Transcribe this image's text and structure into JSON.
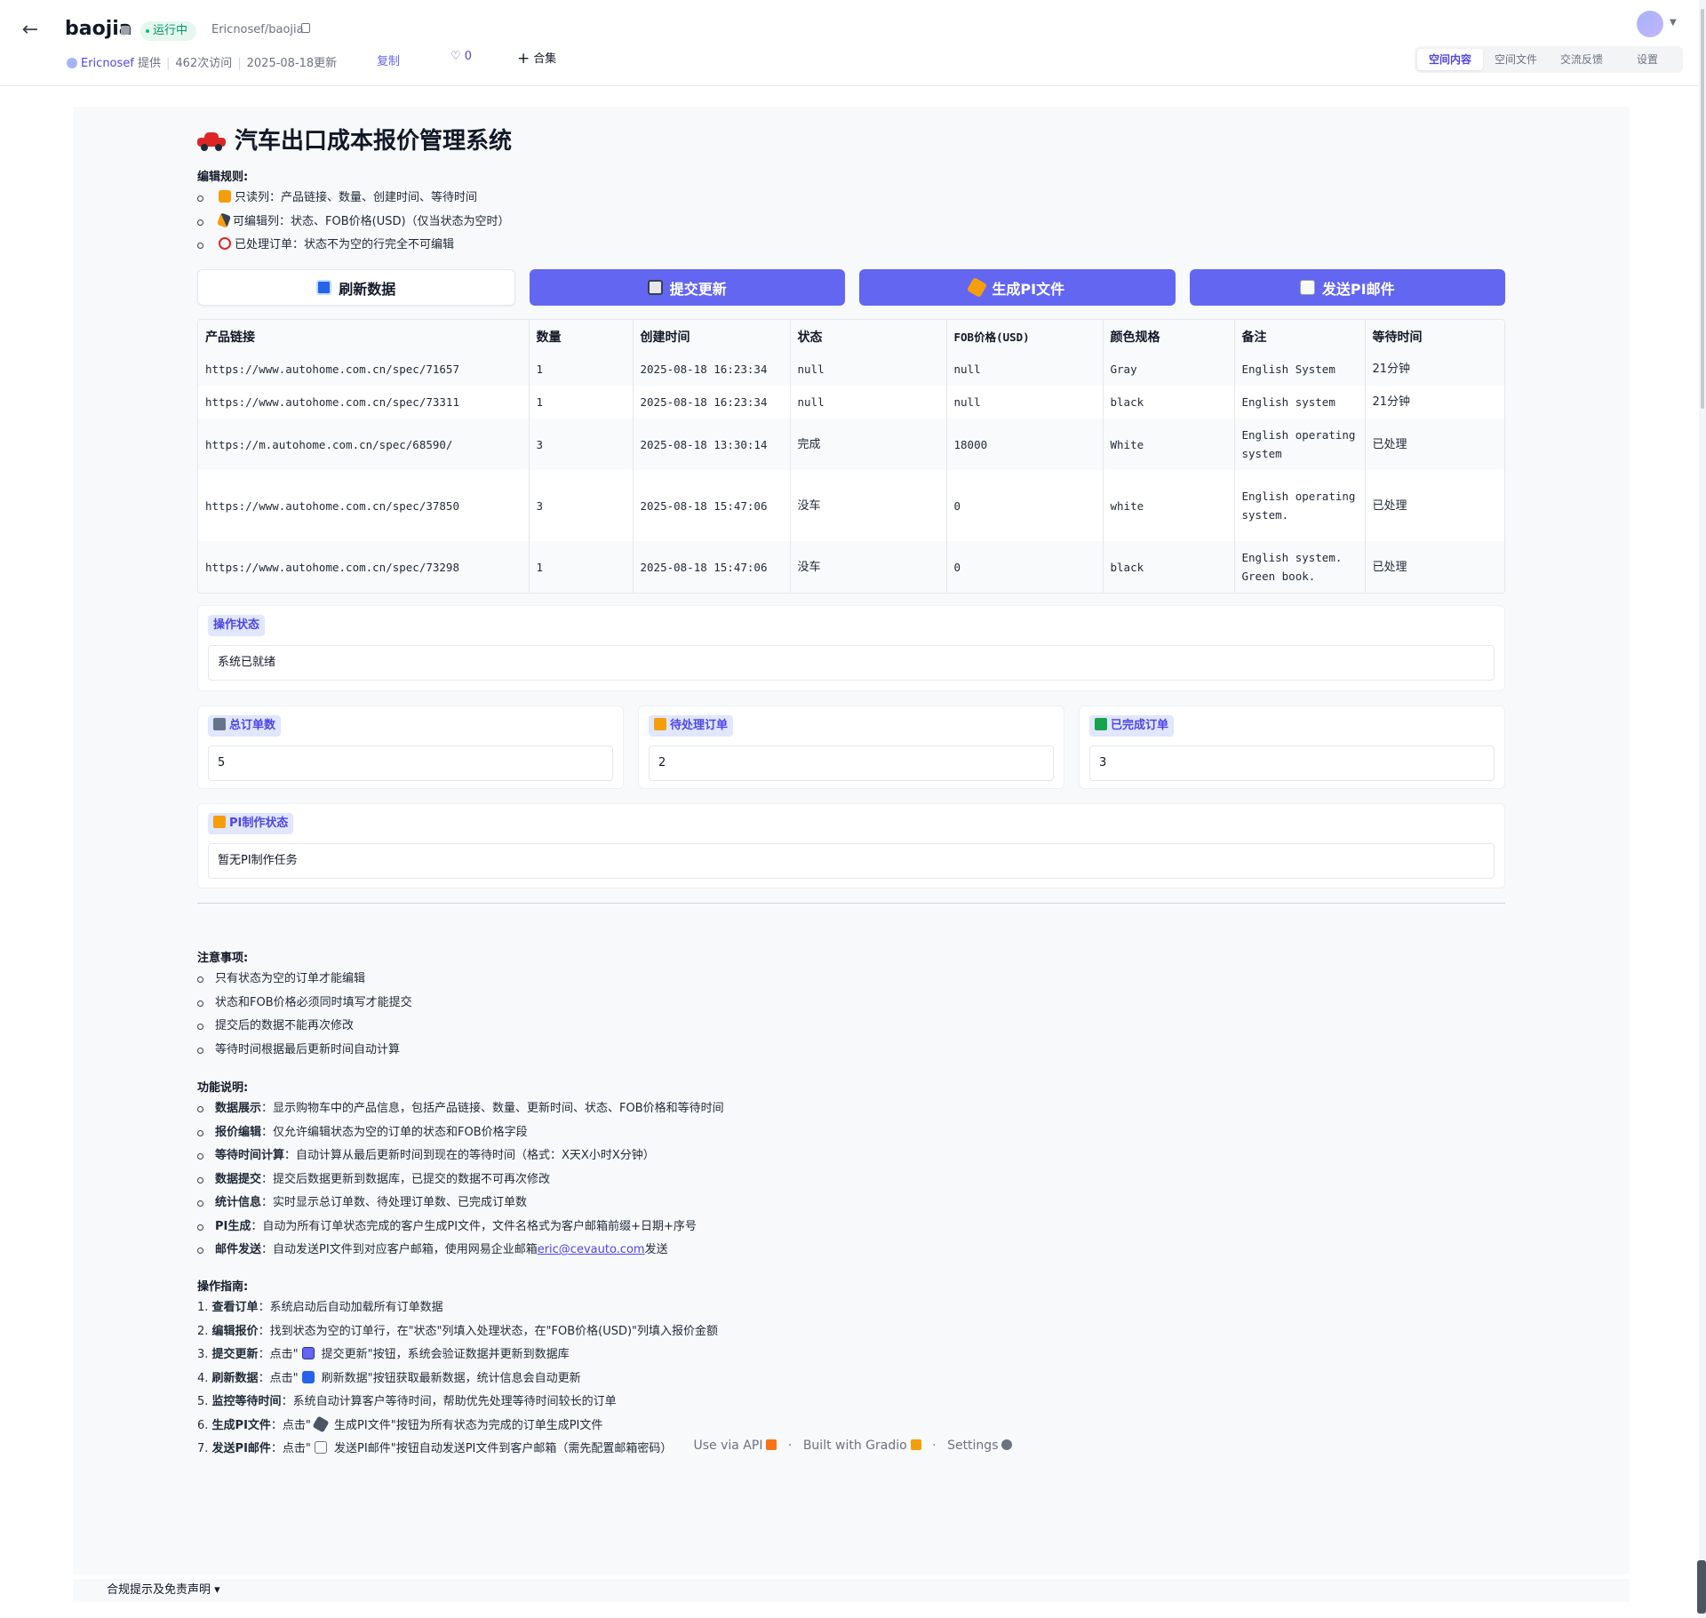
{
  "header": {
    "space_name": "baojia",
    "status": "运行中",
    "repo": "Ericnosef/baojia",
    "author": "Ericnosef",
    "provided": "提供",
    "visits": "462次访问",
    "updated": "2025-08-18更新",
    "copy_label": "复制",
    "likes": "♡ 0",
    "collection": "合集",
    "tabs": [
      "空间内容",
      "空间文件",
      "交流反馈",
      "设置"
    ]
  },
  "app": {
    "title": "汽车出口成本报价管理系统",
    "rules_title": "编辑规则:",
    "rules": [
      {
        "icon": "lock-icon",
        "text": "只读列：产品链接、数量、创建时间、等待时间"
      },
      {
        "icon": "pencil-icon",
        "text": "可编辑列：状态、FOB价格(USD)（仅当状态为空时）"
      },
      {
        "icon": "ban-icon",
        "text": "已处理订单：状态不为空的行完全不可编辑"
      }
    ],
    "buttons": {
      "refresh": "刷新数据",
      "submit": "提交更新",
      "generate_pi": "生成PI文件",
      "send_pi": "发送PI邮件"
    },
    "table": {
      "headers": [
        "产品链接",
        "数量",
        "创建时间",
        "状态",
        "FOB价格(USD)",
        "颜色规格",
        "备注",
        "等待时间"
      ],
      "rows": [
        [
          "https://www.autohome.com.cn/spec/71657",
          "1",
          "2025-08-18 16:23:34",
          "null",
          "null",
          "Gray",
          "English System",
          "21分钟"
        ],
        [
          "https://www.autohome.com.cn/spec/73311",
          "1",
          "2025-08-18 16:23:34",
          "null",
          "null",
          "black",
          "English system",
          "21分钟"
        ],
        [
          "https://m.autohome.com.cn/spec/68590/",
          "3",
          "2025-08-18 13:30:14",
          "完成",
          "18000",
          "White",
          "English operating system",
          "已处理"
        ],
        [
          "https://www.autohome.com.cn/spec/37850",
          "3",
          "2025-08-18 15:47:06",
          "没车",
          "0",
          "white",
          "English operating system.",
          "已处理"
        ],
        [
          "https://www.autohome.com.cn/spec/73298",
          "1",
          "2025-08-18 15:47:06",
          "没车",
          "0",
          "black",
          "English system. Green book.",
          "已处理"
        ]
      ]
    },
    "op_status": {
      "label": "操作状态",
      "value": "系统已就绪"
    },
    "stats": {
      "total": {
        "label": "总订单数",
        "value": "5"
      },
      "pending": {
        "label": "待处理订单",
        "value": "2"
      },
      "done": {
        "label": "已完成订单",
        "value": "3"
      }
    },
    "pi_status": {
      "label": "PI制作状态",
      "value": "暂无PI制作任务"
    },
    "notes_title": "注意事项:",
    "notes": [
      "只有状态为空的订单才能编辑",
      "状态和FOB价格必须同时填写才能提交",
      "提交后的数据不能再次修改",
      "等待时间根据最后更新时间自动计算"
    ],
    "features_title": "功能说明:",
    "features": [
      {
        "name": "数据展示",
        "desc": "：显示购物车中的产品信息，包括产品链接、数量、更新时间、状态、FOB价格和等待时间"
      },
      {
        "name": "报价编辑",
        "desc": "：仅允许编辑状态为空的订单的状态和FOB价格字段"
      },
      {
        "name": "等待时间计算",
        "desc": "：自动计算从最后更新时间到现在的等待时间（格式：X天X小时X分钟）"
      },
      {
        "name": "数据提交",
        "desc": "：提交后数据更新到数据库，已提交的数据不可再次修改"
      },
      {
        "name": "统计信息",
        "desc": "：实时显示总订单数、待处理订单数、已完成订单数"
      },
      {
        "name": "PI生成",
        "desc": "：自动为所有订单状态完成的客户生成PI文件，文件名格式为客户邮箱前缀+日期+序号"
      },
      {
        "name": "邮件发送",
        "desc": "：自动发送PI文件到对应客户邮箱，使用网易企业邮箱",
        "link": "eric@cevauto.com",
        "tail": "发送"
      }
    ],
    "guide_title": "操作指南:",
    "guide": [
      {
        "num": "1.",
        "name": "查看订单",
        "desc": "：系统启动后自动加载所有订单数据"
      },
      {
        "num": "2.",
        "name": "编辑报价",
        "desc": "：找到状态为空的订单行，在\"状态\"列填入处理状态，在\"FOB价格(USD)\"列填入报价金额"
      },
      {
        "num": "3.",
        "name": "提交更新",
        "pre": "：点击\"",
        "post": " 提交更新\"按钮，系统会验证数据并更新到数据库",
        "icon": "save-icon"
      },
      {
        "num": "4.",
        "name": "刷新数据",
        "pre": "：点击\"",
        "post": " 刷新数据\"按钮获取最新数据，统计信息会自动更新",
        "icon": "refresh-icon"
      },
      {
        "num": "5.",
        "name": "监控等待时间",
        "desc": "：系统自动计算客户等待时间，帮助优先处理等待时间较长的订单"
      },
      {
        "num": "6.",
        "name": "生成PI文件",
        "pre": "：点击\"",
        "post": " 生成PI文件\"按钮为所有状态为完成的订单生成PI文件",
        "icon": "hammer-icon"
      },
      {
        "num": "7.",
        "name": "发送PI邮件",
        "pre": "：点击\"",
        "post": " 发送PI邮件\"按钮自动发送PI文件到客户邮箱（需先配置邮箱密码）",
        "icon": "mail-icon"
      }
    ]
  },
  "footer": {
    "api": "Use via API",
    "built": "Built with Gradio",
    "settings": "Settings",
    "disclaimer": "合规提示及免责声明 ▾"
  },
  "colors": {
    "primary": "#6366f1",
    "running_bg": "#e6f7ef",
    "running_text": "#059669"
  }
}
